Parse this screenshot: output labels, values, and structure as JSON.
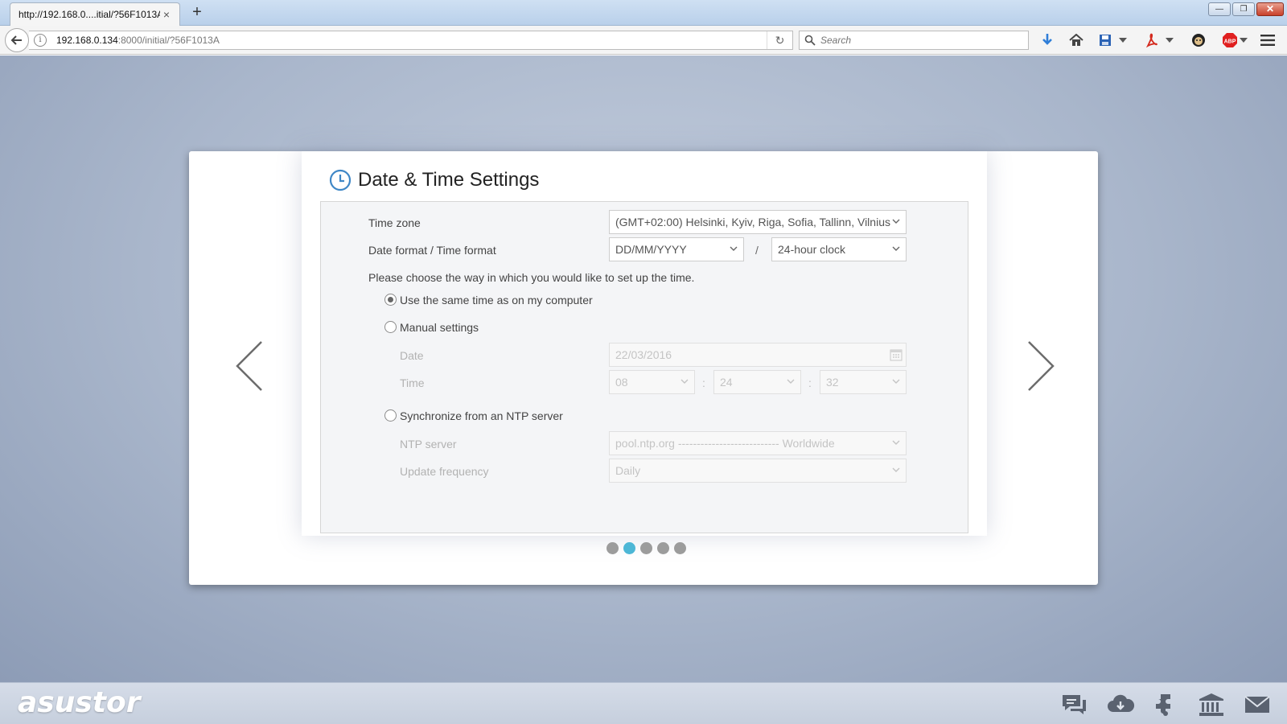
{
  "browser": {
    "tab_title": "http://192.168.0....itial/?56F1013A",
    "tab_close": "×",
    "new_tab": "+",
    "win_min": "—",
    "win_max": "❐",
    "win_close": "✕",
    "url_host": "192.168.0.134",
    "url_path": ":8000/initial/?56F1013A",
    "info": "i",
    "reload": "↻",
    "search_placeholder": "Search",
    "toolbar_icons": [
      "download-icon",
      "home-icon",
      "save-icon",
      "pdf-icon",
      "extension-icon",
      "adblock-icon",
      "menu-icon"
    ],
    "adblock_label": "ABP"
  },
  "page": {
    "title": "Date & Time Settings",
    "timezone_label": "Time zone",
    "timezone_value": "(GMT+02:00) Helsinki, Kyiv, Riga, Sofia, Tallinn, Vilnius",
    "format_label": "Date format / Time format",
    "date_format": "DD/MM/YYYY",
    "format_sep": "/",
    "time_format": "24-hour clock",
    "instruction": "Please choose the way in which you would like to set up the time.",
    "option_same": "Use the same time as on my computer",
    "option_manual": "Manual settings",
    "date_label": "Date",
    "date_value": "22/03/2016",
    "time_label": "Time",
    "hour": "08",
    "minute": "24",
    "second": "32",
    "time_sep": ":",
    "option_ntp": "Synchronize from an NTP server",
    "ntp_label": "NTP server",
    "ntp_value": "pool.ntp.org --------------------------- Worldwide",
    "freq_label": "Update frequency",
    "freq_value": "Daily",
    "selected_option": "same",
    "steps_total": 5,
    "step_active": 2
  },
  "footer": {
    "brand": "asustor",
    "icons": [
      "chat-icon",
      "cloud-download-icon",
      "app-central-icon",
      "bank-icon",
      "mail-icon"
    ]
  },
  "colors": {
    "accent": "#4db7d6",
    "icon_blue": "#3f87c6",
    "background": "#a9b6cb"
  }
}
